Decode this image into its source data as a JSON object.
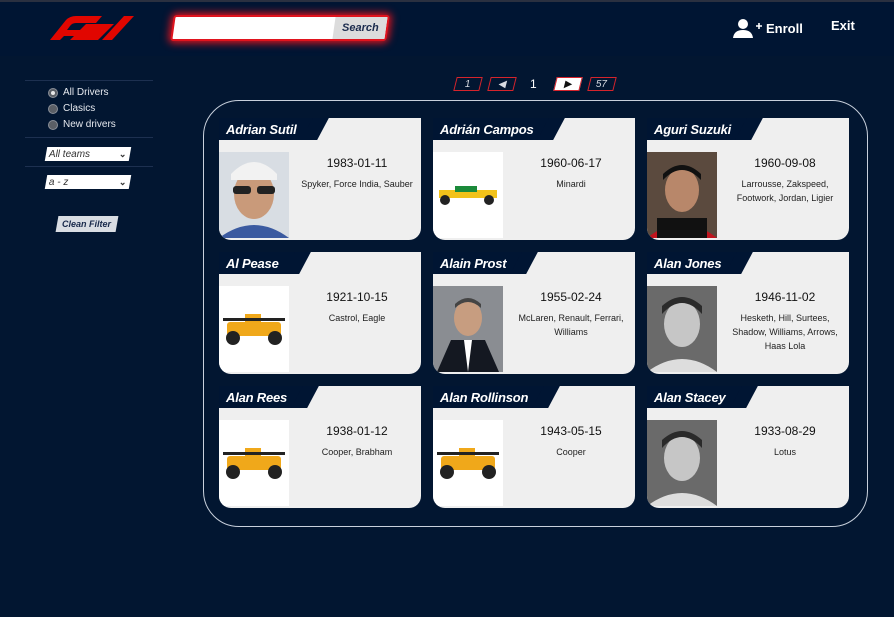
{
  "header": {
    "logo_label": "F1",
    "search": {
      "value": "",
      "placeholder": "",
      "button_label": "Search"
    },
    "enroll_label": "Enroll",
    "exit_label": "Exit"
  },
  "filters": {
    "radios": [
      {
        "label": "All Drivers",
        "checked": true
      },
      {
        "label": "Clasics",
        "checked": false
      },
      {
        "label": "New drivers",
        "checked": false
      }
    ],
    "team_select": "All teams",
    "sort_select": "a - z",
    "clean_label": "Clean Filter"
  },
  "pagination": {
    "first": "1",
    "prev": "◀",
    "current": "1",
    "next": "▶",
    "last": "57"
  },
  "drivers": [
    {
      "name": "Adrian Sutil",
      "birth": "1983-01-11",
      "teams": "Spyker, Force India, Sauber",
      "photo": "portrait-cap-icon"
    },
    {
      "name": "Adrián Campos",
      "birth": "1960-06-17",
      "teams": "Minardi",
      "photo": "race-car-icon"
    },
    {
      "name": "Aguri Suzuki",
      "birth": "1960-09-08",
      "teams": "Larrousse, Zakspeed, Footwork, Jordan, Ligier",
      "photo": "portrait-icon"
    },
    {
      "name": "Al Pease",
      "birth": "1921-10-15",
      "teams": "Castrol, Eagle",
      "photo": "f1-car-icon"
    },
    {
      "name": "Alain Prost",
      "birth": "1955-02-24",
      "teams": "McLaren, Renault, Ferrari, Williams",
      "photo": "portrait-suit-icon"
    },
    {
      "name": "Alan Jones",
      "birth": "1946-11-02",
      "teams": "Hesketh, Hill, Surtees, Shadow, Williams, Arrows, Haas Lola",
      "photo": "portrait-bw-icon"
    },
    {
      "name": "Alan Rees",
      "birth": "1938-01-12",
      "teams": "Cooper, Brabham",
      "photo": "f1-car-icon"
    },
    {
      "name": "Alan Rollinson",
      "birth": "1943-05-15",
      "teams": "Cooper",
      "photo": "f1-car-icon"
    },
    {
      "name": "Alan Stacey",
      "birth": "1933-08-29",
      "teams": "Lotus",
      "photo": "portrait-bw-icon"
    }
  ],
  "colors": {
    "background": "#021631",
    "accent": "#e0141e",
    "card": "#efefef"
  }
}
